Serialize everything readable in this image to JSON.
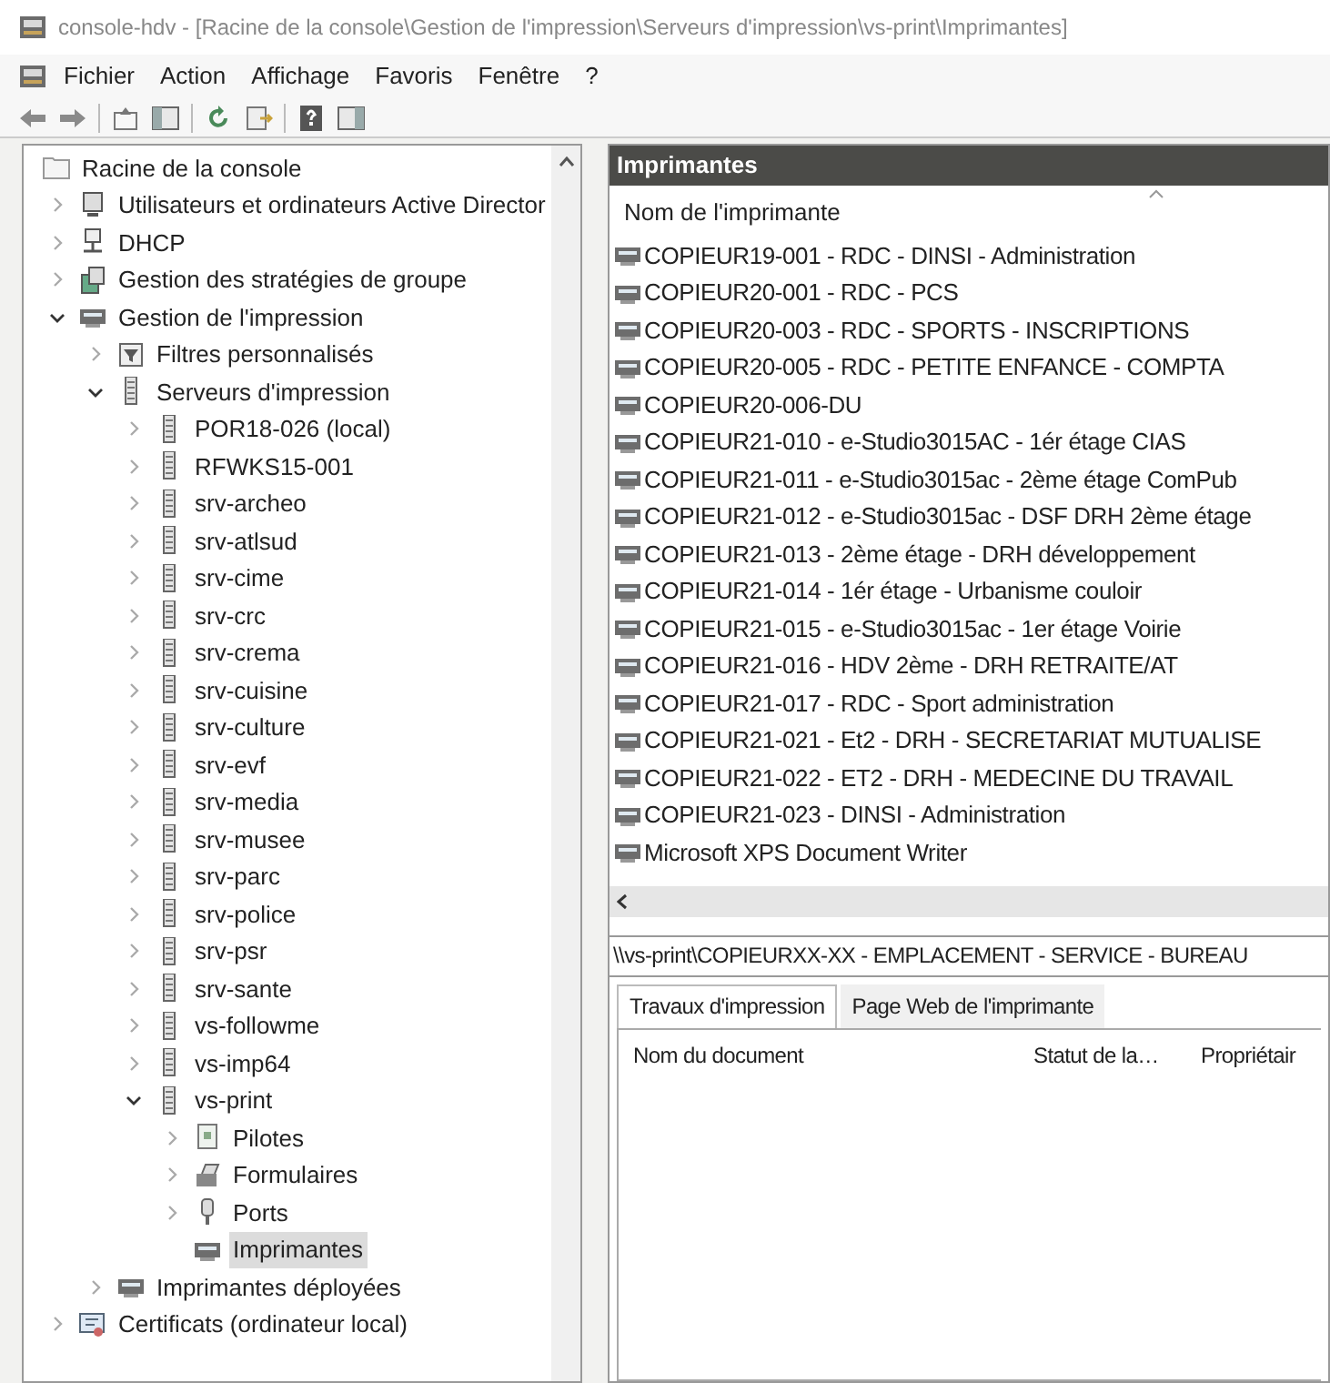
{
  "window": {
    "title": "console-hdv - [Racine de la console\\Gestion de l'impression\\Serveurs d'impression\\vs-print\\Imprimantes]"
  },
  "menu": [
    "Fichier",
    "Action",
    "Affichage",
    "Favoris",
    "Fenêtre",
    "?"
  ],
  "tree": [
    {
      "label": "Racine de la console",
      "kind": "folder",
      "selected": false,
      "children": [
        {
          "label": "Utilisateurs et ordinateurs Active Director",
          "kind": "computer",
          "expanded": false,
          "selected": false
        },
        {
          "label": "DHCP",
          "kind": "network",
          "expanded": false,
          "selected": false
        },
        {
          "label": "Gestion des stratégies de groupe",
          "kind": "policy",
          "expanded": false,
          "selected": false
        },
        {
          "label": "Gestion de l'impression",
          "kind": "printer",
          "expanded": true,
          "selected": false,
          "children": [
            {
              "label": "Filtres personnalisés",
              "kind": "filter",
              "expanded": false,
              "selected": false
            },
            {
              "label": "Serveurs d'impression",
              "kind": "server",
              "expanded": true,
              "selected": false,
              "children": [
                {
                  "label": "POR18-026 (local)",
                  "kind": "server",
                  "expanded": false,
                  "selected": false
                },
                {
                  "label": "RFWKS15-001",
                  "kind": "server",
                  "expanded": false,
                  "selected": false
                },
                {
                  "label": "srv-archeo",
                  "kind": "server",
                  "expanded": false,
                  "selected": false
                },
                {
                  "label": "srv-atlsud",
                  "kind": "server",
                  "expanded": false,
                  "selected": false
                },
                {
                  "label": "srv-cime",
                  "kind": "server",
                  "expanded": false,
                  "selected": false
                },
                {
                  "label": "srv-crc",
                  "kind": "server",
                  "expanded": false,
                  "selected": false
                },
                {
                  "label": "srv-crema",
                  "kind": "server",
                  "expanded": false,
                  "selected": false
                },
                {
                  "label": "srv-cuisine",
                  "kind": "server",
                  "expanded": false,
                  "selected": false
                },
                {
                  "label": "srv-culture",
                  "kind": "server",
                  "expanded": false,
                  "selected": false
                },
                {
                  "label": "srv-evf",
                  "kind": "server",
                  "expanded": false,
                  "selected": false
                },
                {
                  "label": "srv-media",
                  "kind": "server",
                  "expanded": false,
                  "selected": false
                },
                {
                  "label": "srv-musee",
                  "kind": "server",
                  "expanded": false,
                  "selected": false
                },
                {
                  "label": "srv-parc",
                  "kind": "server",
                  "expanded": false,
                  "selected": false
                },
                {
                  "label": "srv-police",
                  "kind": "server",
                  "expanded": false,
                  "selected": false
                },
                {
                  "label": "srv-psr",
                  "kind": "server",
                  "expanded": false,
                  "selected": false
                },
                {
                  "label": "srv-sante",
                  "kind": "server",
                  "expanded": false,
                  "selected": false
                },
                {
                  "label": "vs-followme",
                  "kind": "server",
                  "expanded": false,
                  "selected": false
                },
                {
                  "label": "vs-imp64",
                  "kind": "server",
                  "expanded": false,
                  "selected": false
                },
                {
                  "label": "vs-print",
                  "kind": "server",
                  "expanded": true,
                  "selected": false,
                  "children": [
                    {
                      "label": "Pilotes",
                      "kind": "page",
                      "expanded": false,
                      "selected": false
                    },
                    {
                      "label": "Formulaires",
                      "kind": "forms",
                      "expanded": false,
                      "selected": false
                    },
                    {
                      "label": "Ports",
                      "kind": "port",
                      "expanded": false,
                      "selected": false
                    },
                    {
                      "label": "Imprimantes",
                      "kind": "printer",
                      "selected": true
                    }
                  ]
                }
              ]
            },
            {
              "label": "Imprimantes déployées",
              "kind": "printer",
              "expanded": false,
              "selected": false
            }
          ]
        },
        {
          "label": "Certificats (ordinateur local)",
          "kind": "certificate",
          "expanded": false,
          "selected": false
        }
      ]
    }
  ],
  "printers_pane": {
    "title": "Imprimantes",
    "column": "Nom de l'imprimante",
    "rows": [
      "COPIEUR19-001 - RDC - DINSI - Administration",
      "COPIEUR20-001 - RDC - PCS",
      "COPIEUR20-003 - RDC - SPORTS - INSCRIPTIONS",
      "COPIEUR20-005 - RDC - PETITE ENFANCE - COMPTA",
      "COPIEUR20-006-DU",
      "COPIEUR21-010 - e-Studio3015AC - 1ér étage CIAS",
      "COPIEUR21-011 - e-Studio3015ac - 2ème étage ComPub",
      "COPIEUR21-012 - e-Studio3015ac - DSF DRH 2ème étage",
      "COPIEUR21-013 - 2ème étage - DRH développement",
      "COPIEUR21-014 - 1ér étage - Urbanisme couloir",
      "COPIEUR21-015 - e-Studio3015ac - 1er étage Voirie",
      "COPIEUR21-016 - HDV 2ème - DRH RETRAITE/AT",
      "COPIEUR21-017 - RDC - Sport administration",
      "COPIEUR21-021 - Et2 - DRH - SECRETARIAT MUTUALISE",
      "COPIEUR21-022 - ET2 - DRH - MEDECINE DU TRAVAIL",
      "COPIEUR21-023 - DINSI - Administration",
      "Microsoft XPS Document Writer"
    ]
  },
  "details": {
    "path": "\\\\vs-print\\COPIEURXX-XX - EMPLACEMENT - SERVICE - BUREAU",
    "tabs": [
      {
        "label": "Travaux d'impression",
        "selected": true
      },
      {
        "label": "Page Web de l'imprimante",
        "selected": false
      }
    ],
    "columns": [
      "Nom du document",
      "Statut de la…",
      "Propriétair"
    ]
  }
}
